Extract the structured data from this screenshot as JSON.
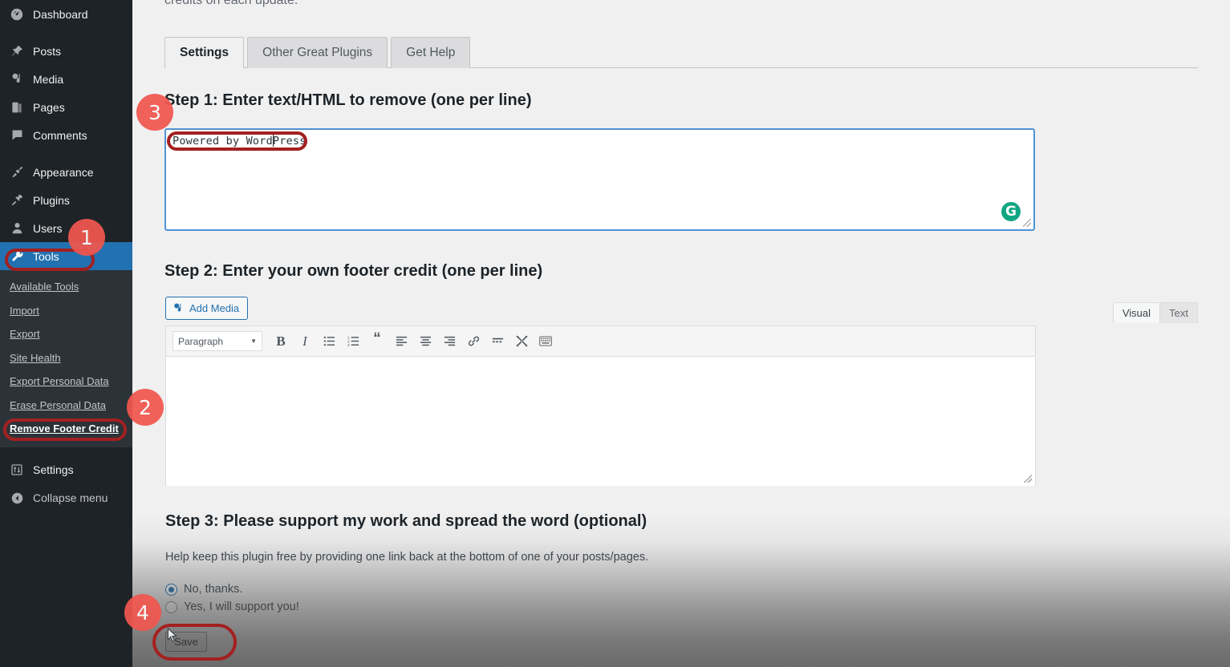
{
  "sidebar": {
    "items": [
      {
        "label": "Dashboard",
        "icon": "dashboard-icon"
      },
      {
        "label": "Posts",
        "icon": "pin-icon"
      },
      {
        "label": "Media",
        "icon": "media-icon"
      },
      {
        "label": "Pages",
        "icon": "pages-icon"
      },
      {
        "label": "Comments",
        "icon": "comments-icon"
      },
      {
        "label": "Appearance",
        "icon": "appearance-icon"
      },
      {
        "label": "Plugins",
        "icon": "plugins-icon"
      },
      {
        "label": "Users",
        "icon": "users-icon"
      },
      {
        "label": "Tools",
        "icon": "tools-icon"
      }
    ],
    "current_item": "Tools",
    "submenu": [
      "Available Tools",
      "Import",
      "Export",
      "Site Health",
      "Export Personal Data",
      "Erase Personal Data",
      "Remove Footer Credit"
    ],
    "submenu_current": "Remove Footer Credit",
    "settings_label": "Settings",
    "collapse_label": "Collapse menu",
    "active_color": "#2271b1",
    "bg_color": "#1d2327",
    "submenu_bg_color": "#2c3338"
  },
  "content": {
    "intro_cut_text": "credits on each update.",
    "tabs": [
      {
        "label": "Settings",
        "active": true
      },
      {
        "label": "Other Great Plugins",
        "active": false
      },
      {
        "label": "Get Help",
        "active": false
      }
    ],
    "step1": {
      "title": "Step 1: Enter text/HTML to remove (one per line)",
      "textarea_value": "Powered by WordPress",
      "grammarly_glyph": "G"
    },
    "step2": {
      "title": "Step 2: Enter your own footer credit (one per line)",
      "add_media_label": "Add Media",
      "visual_tab": "Visual",
      "text_tab": "Text",
      "format_select_value": "Paragraph",
      "toolbar_buttons": [
        {
          "name": "bold-icon",
          "glyph": "B"
        },
        {
          "name": "italic-icon",
          "glyph": "I"
        },
        {
          "name": "bulleted-list-icon",
          "glyph": "☰"
        },
        {
          "name": "numbered-list-icon",
          "glyph": "☰"
        },
        {
          "name": "blockquote-icon",
          "glyph": "“"
        },
        {
          "name": "align-left-icon",
          "glyph": "≡"
        },
        {
          "name": "align-center-icon",
          "glyph": "≡"
        },
        {
          "name": "align-right-icon",
          "glyph": "≡"
        },
        {
          "name": "insert-link-icon",
          "glyph": "🔗"
        },
        {
          "name": "read-more-icon",
          "glyph": "═"
        },
        {
          "name": "fullscreen-icon",
          "glyph": "✕"
        },
        {
          "name": "keyboard-shortcuts-icon",
          "glyph": "⌨"
        }
      ],
      "editor_value": ""
    },
    "step3": {
      "title": "Step 3: Please support my work and spread the word (optional)",
      "help_text": "Help keep this plugin free by providing one link back at the bottom of one of your posts/pages.",
      "options": [
        {
          "label": "No, thanks.",
          "checked": true
        },
        {
          "label": "Yes, I will support you!",
          "checked": false
        }
      ]
    },
    "save_label": "Save"
  },
  "annotations": {
    "badge_color": "#f0574f",
    "ring_color": "#a32020",
    "badges": [
      {
        "number": "1",
        "target": "sidebar-item-tools"
      },
      {
        "number": "2",
        "target": "submenu-item-remove-footer-credit"
      },
      {
        "number": "3",
        "target": "step1-textarea"
      },
      {
        "number": "4",
        "target": "save-button"
      }
    ]
  }
}
